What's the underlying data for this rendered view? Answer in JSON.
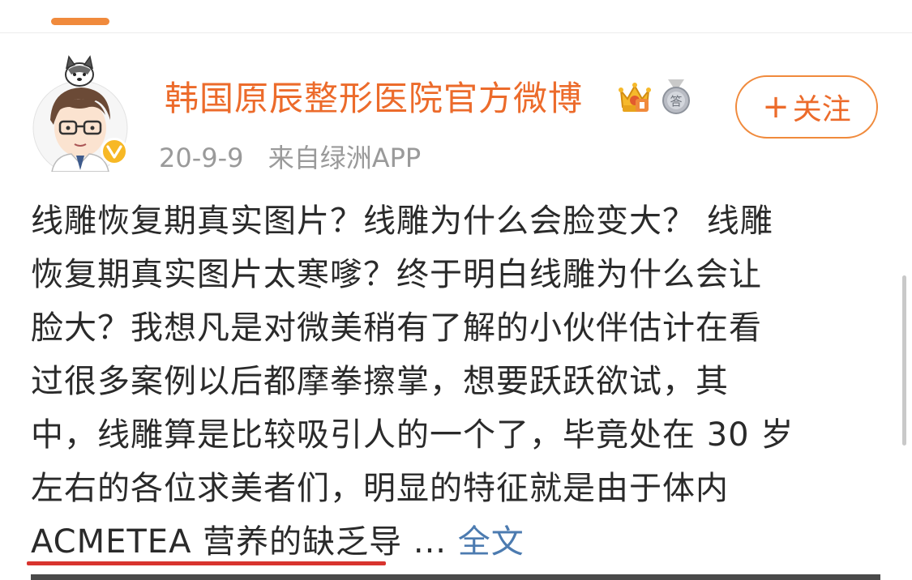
{
  "post": {
    "username": "韩国原辰整形医院官方微博",
    "date": "20-9-9",
    "source": "来自绿洲APP",
    "follow_label": "关注",
    "follow_plus": "+",
    "text_lines": [
      "线雕恢复期真实图片？线雕为什么会脸变大？ 线雕",
      "恢复期真实图片太寒嗲？终于明白线雕为什么会让",
      "脸大？我想凡是对微美稍有了解的小伙伴估计在看",
      "过很多案例以后都摩拳擦掌，想要跃跃欲试，其",
      "中，线雕算是比较吸引人的一个了，毕竟处在 30 岁",
      "左右的各位求美者们，明显的特征就是由于体内",
      "ACMETEA 营养的缺乏导 ..."
    ],
    "full_text_link": "全文"
  },
  "icons": {
    "avatar": "doctor-cartoon-avatar",
    "verified": "verified-v-icon",
    "crown": "crown-badge-icon",
    "medal": "medal-badge-icon"
  },
  "colors": {
    "accent": "#ec6b2b",
    "link": "#4c7bb0",
    "underline": "#d8342e",
    "verified": "#f7b825"
  }
}
